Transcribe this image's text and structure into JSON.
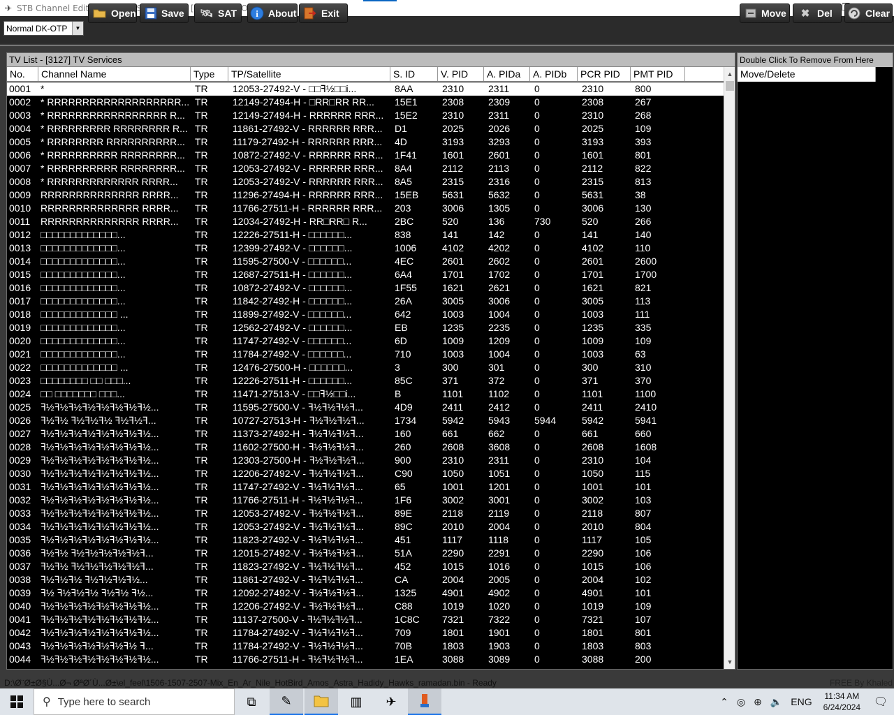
{
  "window": {
    "title": "STB Channel Editor [SUNPLUS_DK_OTP] - [Normal DK-OTP]",
    "controls": [
      "—",
      "❐",
      "✕"
    ]
  },
  "toolbar": {
    "mode_value": "Normal DK-OTP",
    "open_label": "Open",
    "save_label": "Save",
    "sat_label": "SAT",
    "about_label": "About",
    "exit_label": "Exit",
    "move_label": "Move",
    "del_label": "Del",
    "clear_label": "Clear"
  },
  "left_panel": {
    "title": "TV List - [3127] TV Services",
    "columns": [
      "No.",
      "Channel Name",
      "Type",
      "TP/Satellite",
      "S. ID",
      "V. PID",
      "A. PIDa",
      "A. PIDb",
      "PCR PID",
      "PMT PID"
    ],
    "rows": [
      [
        "0001",
        "*",
        "TR",
        "12053-27492-V - □□ꟻ½□□i...",
        "8AA",
        "2310",
        "2311",
        "0",
        "2310",
        "800"
      ],
      [
        "0002",
        "* RRRRRRRRRRRRRRRRRRR...",
        "TR",
        "12149-27494-H - □RR□RR RR...",
        "15E1",
        "2308",
        "2309",
        "0",
        "2308",
        "267"
      ],
      [
        "0003",
        "* RRRRRRRRRRRRRRRRR R...",
        "TR",
        "12149-27494-H - RRRRRR RRR...",
        "15E2",
        "2310",
        "2311",
        "0",
        "2310",
        "268"
      ],
      [
        "0004",
        "* RRRRRRRRR RRRRRRRR R...",
        "TR",
        "11861-27492-V - RRRRRR RRR...",
        "D1",
        "2025",
        "2026",
        "0",
        "2025",
        "109"
      ],
      [
        "0005",
        "* RRRRRRRR RRRRRRRRRR...",
        "TR",
        "11179-27492-H - RRRRRR RRR...",
        "4D",
        "3193",
        "3293",
        "0",
        "3193",
        "393"
      ],
      [
        "0006",
        "* RRRRRRRRRR RRRRRRRR...",
        "TR",
        "10872-27492-V - RRRRRR RRR...",
        "1F41",
        "1601",
        "2601",
        "0",
        "1601",
        "801"
      ],
      [
        "0007",
        "* RRRRRRRRRR RRRRRRRR...",
        "TR",
        "12053-27492-V - RRRRRR RRR...",
        "8A4",
        "2112",
        "2113",
        "0",
        "2112",
        "822"
      ],
      [
        "0008",
        "* RRRRRRRRRRRRR RRRR...",
        "TR",
        "12053-27492-V - RRRRRR RRR...",
        "8A5",
        "2315",
        "2316",
        "0",
        "2315",
        "813"
      ],
      [
        "0009",
        "RRRRRRRRRRRRRR RRRR...",
        "TR",
        "11296-27494-H - RRRRRR RRR...",
        "15EB",
        "5631",
        "5632",
        "0",
        "5631",
        "38"
      ],
      [
        "0010",
        "RRRRRRRRRRRRRR RRRR...",
        "TR",
        "11766-27511-H - RRRRRR RRR...",
        "203",
        "3006",
        "1305",
        "0",
        "3006",
        "130"
      ],
      [
        "0011",
        "RRRRRRRRRRRRRR RRRR...",
        "TR",
        "12034-27492-H - RR□RR□ R...",
        "2BC",
        "520",
        "136",
        "730",
        "520",
        "266"
      ],
      [
        "0012",
        "□□□□□□□□□□□□□...",
        "TR",
        "12226-27511-H - □□□□□□...",
        "838",
        "141",
        "142",
        "0",
        "141",
        "140"
      ],
      [
        "0013",
        "□□□□□□□□□□□□□...",
        "TR",
        "12399-27492-V - □□□□□□...",
        "1006",
        "4102",
        "4202",
        "0",
        "4102",
        "110"
      ],
      [
        "0014",
        "□□□□□□□□□□□□□...",
        "TR",
        "11595-27500-V - □□□□□□...",
        "4EC",
        "2601",
        "2602",
        "0",
        "2601",
        "2600"
      ],
      [
        "0015",
        "□□□□□□□□□□□□□...",
        "TR",
        "12687-27511-H - □□□□□□...",
        "6A4",
        "1701",
        "1702",
        "0",
        "1701",
        "1700"
      ],
      [
        "0016",
        "□□□□□□□□□□□□□...",
        "TR",
        "10872-27492-V - □□□□□□...",
        "1F55",
        "1621",
        "2621",
        "0",
        "1621",
        "821"
      ],
      [
        "0017",
        "□□□□□□□□□□□□□...",
        "TR",
        "11842-27492-H - □□□□□□...",
        "26A",
        "3005",
        "3006",
        "0",
        "3005",
        "113"
      ],
      [
        "0018",
        "□□□□□□□□□□□□□ ...",
        "TR",
        "11899-27492-V - □□□□□□...",
        "642",
        "1003",
        "1004",
        "0",
        "1003",
        "111"
      ],
      [
        "0019",
        "□□□□□□□□□□□□□...",
        "TR",
        "12562-27492-V - □□□□□□...",
        "EB",
        "1235",
        "2235",
        "0",
        "1235",
        "335"
      ],
      [
        "0020",
        "□□□□□□□□□□□□□...",
        "TR",
        "11747-27492-V - □□□□□□...",
        "6D",
        "1009",
        "1209",
        "0",
        "1009",
        "109"
      ],
      [
        "0021",
        "□□□□□□□□□□□□□...",
        "TR",
        "11784-27492-V - □□□□□□...",
        "710",
        "1003",
        "1004",
        "0",
        "1003",
        "63"
      ],
      [
        "0022",
        "□□□□□□□□□□□□□ ...",
        "TR",
        "12476-27500-H - □□□□□□...",
        "3",
        "300",
        "301",
        "0",
        "300",
        "310"
      ],
      [
        "0023",
        "□□□□□□□□ □□ □□□...",
        "TR",
        "12226-27511-H - □□□□□□...",
        "85C",
        "371",
        "372",
        "0",
        "371",
        "370"
      ],
      [
        "0024",
        "□□ □□□□□□□ □□□...",
        "TR",
        "11471-27513-V - □□ꟻ½□□i...",
        "B",
        "1101",
        "1102",
        "0",
        "1101",
        "1100"
      ],
      [
        "0025",
        "ꟻ½ꟻ½ꟻ½ꟻ½ꟻ½ꟻ½ꟻ½ꟻ½...",
        "TR",
        "11595-27500-V - ꟻ½ꟻ½ꟻ½ꟻ...",
        "4D9",
        "2411",
        "2412",
        "0",
        "2411",
        "2410"
      ],
      [
        "0026",
        "ꟻ½ꟻ½ ꟻ½ꟻ½ꟻ½ ꟻ½ꟻ½ꟻ...",
        "TR",
        "10727-27513-H - ꟻ½ꟻ½ꟻ½ꟻ...",
        "1734",
        "5942",
        "5943",
        "5944",
        "5942",
        "5941"
      ],
      [
        "0027",
        "ꟻ½ꟻ½ꟻ½ꟻ½ꟻ½ꟻ½ꟻ½ꟻ½...",
        "TR",
        "11373-27492-H - ꟻ½ꟻ½ꟻ½ꟻ...",
        "160",
        "661",
        "662",
        "0",
        "661",
        "660"
      ],
      [
        "0028",
        "ꟻ½ꟻ½ꟻ½ꟻ½ꟻ½ꟻ½ꟻ½ꟻ½...",
        "TR",
        "11602-27500-H - ꟻ½ꟻ½ꟻ½ꟻ...",
        "260",
        "2608",
        "3608",
        "0",
        "2608",
        "1608"
      ],
      [
        "0029",
        "ꟻ½ꟻ½ꟻ½ꟻ½ꟻ½ꟻ½ꟻ½ꟻ½...",
        "TR",
        "12303-27500-H - ꟻ½ꟻ½ꟻ½ꟻ...",
        "900",
        "2310",
        "2311",
        "0",
        "2310",
        "104"
      ],
      [
        "0030",
        "ꟻ½ꟻ½ꟻ½ꟻ½ꟻ½ꟻ½ꟻ½ꟻ½...",
        "TR",
        "12206-27492-V - ꟻ½ꟻ½ꟻ½ꟻ...",
        "C90",
        "1050",
        "1051",
        "0",
        "1050",
        "115"
      ],
      [
        "0031",
        "ꟻ½ꟻ½ꟻ½ꟻ½ꟻ½ꟻ½ꟻ½ꟻ½...",
        "TR",
        "11747-27492-V - ꟻ½ꟻ½ꟻ½ꟻ...",
        "65",
        "1001",
        "1201",
        "0",
        "1001",
        "101"
      ],
      [
        "0032",
        "ꟻ½ꟻ½ꟻ½ꟻ½ꟻ½ꟻ½ꟻ½ꟻ½...",
        "TR",
        "11766-27511-H - ꟻ½ꟻ½ꟻ½ꟻ...",
        "1F6",
        "3002",
        "3001",
        "0",
        "3002",
        "103"
      ],
      [
        "0033",
        "ꟻ½ꟻ½ꟻ½ꟻ½ꟻ½ꟻ½ꟻ½ꟻ½...",
        "TR",
        "12053-27492-V - ꟻ½ꟻ½ꟻ½ꟻ...",
        "89E",
        "2118",
        "2119",
        "0",
        "2118",
        "807"
      ],
      [
        "0034",
        "ꟻ½ꟻ½ꟻ½ꟻ½ꟻ½ꟻ½ꟻ½ꟻ½...",
        "TR",
        "12053-27492-V - ꟻ½ꟻ½ꟻ½ꟻ...",
        "89C",
        "2010",
        "2004",
        "0",
        "2010",
        "804"
      ],
      [
        "0035",
        "ꟻ½ꟻ½ꟻ½ꟻ½ꟻ½ꟻ½ꟻ½ꟻ½...",
        "TR",
        "11823-27492-V - ꟻ½ꟻ½ꟻ½ꟻ...",
        "451",
        "1117",
        "1118",
        "0",
        "1117",
        "105"
      ],
      [
        "0036",
        "ꟻ½ꟻ½ ꟻ½ꟻ½ꟻ½ꟻ½ꟻ½ꟻ...",
        "TR",
        "12015-27492-V - ꟻ½ꟻ½ꟻ½ꟻ...",
        "51A",
        "2290",
        "2291",
        "0",
        "2290",
        "106"
      ],
      [
        "0037",
        "ꟻ½ꟻ½ ꟻ½ꟻ½ꟻ½ꟻ½ꟻ½ꟻ...",
        "TR",
        "11823-27492-V - ꟻ½ꟻ½ꟻ½ꟻ...",
        "452",
        "1015",
        "1016",
        "0",
        "1015",
        "106"
      ],
      [
        "0038",
        "ꟻ½ꟻ½ꟻ½ ꟻ½ꟻ½ꟻ½ꟻ½...",
        "TR",
        "11861-27492-V - ꟻ½ꟻ½ꟻ½ꟻ...",
        "CA",
        "2004",
        "2005",
        "0",
        "2004",
        "102"
      ],
      [
        "0039",
        "ꟻ½ ꟻ½ꟻ½ꟻ½ ꟻ½ꟻ½ ꟻ½...",
        "TR",
        "12092-27492-V - ꟻ½ꟻ½ꟻ½ꟻ...",
        "1325",
        "4901",
        "4902",
        "0",
        "4901",
        "101"
      ],
      [
        "0040",
        "ꟻ½ꟻ½ꟻ½ꟻ½ꟻ½ꟻ½ꟻ½ꟻ½...",
        "TR",
        "12206-27492-V - ꟻ½ꟻ½ꟻ½ꟻ...",
        "C88",
        "1019",
        "1020",
        "0",
        "1019",
        "109"
      ],
      [
        "0041",
        "ꟻ½ꟻ½ꟻ½ꟻ½ꟻ½ꟻ½ꟻ½ꟻ½...",
        "TR",
        "11137-27500-V - ꟻ½ꟻ½ꟻ½ꟻ...",
        "1C8C",
        "7321",
        "7322",
        "0",
        "7321",
        "107"
      ],
      [
        "0042",
        "ꟻ½ꟻ½ꟻ½ꟻ½ꟻ½ꟻ½ꟻ½ꟻ½...",
        "TR",
        "11784-27492-V - ꟻ½ꟻ½ꟻ½ꟻ...",
        "709",
        "1801",
        "1901",
        "0",
        "1801",
        "801"
      ],
      [
        "0043",
        "ꟻ½ꟻ½ꟻ½ꟻ½ꟻ½ꟻ½ꟻ½ ꟻ...",
        "TR",
        "11784-27492-V - ꟻ½ꟻ½ꟻ½ꟻ...",
        "70B",
        "1803",
        "1903",
        "0",
        "1803",
        "803"
      ],
      [
        "0044",
        "ꟻ½ꟻ½ꟻ½ꟻ½ꟻ½ꟻ½ꟻ½ꟻ½...",
        "TR",
        "11766-27511-H - ꟻ½ꟻ½ꟻ½ꟻ...",
        "1EA",
        "3088",
        "3089",
        "0",
        "3088",
        "200"
      ]
    ]
  },
  "right_panel": {
    "title": "Double Click To Remove From Here",
    "column": "Move/Delete"
  },
  "status": {
    "path": "D:\\Ø¨Ø±Ø§Ù...Ø¬ ØªØ´Ù...Ø±\\el_feel\\1506-1507-2507-Mix_En_Ar_Nile_HotBird_Amos_Astra_Hadidy_Hawks_ramadan.bin - Ready",
    "credit": "FREE By Khaled"
  },
  "taskbar": {
    "search_placeholder": "Type here to search",
    "lang": "ENG",
    "time": "11:34 AM",
    "date": "6/24/2024"
  }
}
